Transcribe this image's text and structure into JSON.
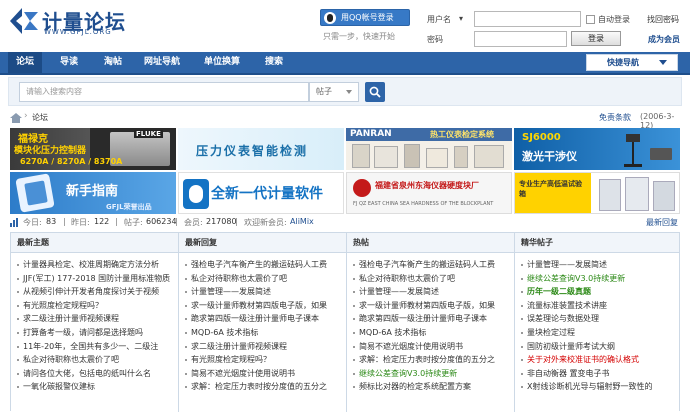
{
  "header": {
    "logo_cn": "计量论坛",
    "logo_url": "WWW.GFJL.ORG",
    "qq_login": "用QQ帐号登录",
    "quick_hint": "只需一步，快速开始",
    "username_label": "用户名",
    "password_label": "密码",
    "auto_login": "自动登录",
    "forgot_password": "找回密码",
    "login_button": "登录",
    "register": "成为会员"
  },
  "nav": {
    "items": [
      "论坛",
      "导读",
      "淘帖",
      "网址导航",
      "单位换算",
      "搜索"
    ],
    "quick_nav": "快捷导航"
  },
  "search": {
    "placeholder": "请输入搜索内容",
    "type": "帖子"
  },
  "breadcrumb": {
    "current": "论坛",
    "disclaimer": "免责条款",
    "date": "(2006-3-12)"
  },
  "banners": {
    "b1_l1": "福禄克",
    "b1_l2": "模块化压力控制器",
    "b1_l3": "6270A / 8270A / 8370A",
    "b1_brand": "FLUKE",
    "b2": "压力仪表智能检测",
    "b3_brand": "PANRAN",
    "b3_text": "热工仪表检定系统",
    "b4_model": "SJ6000",
    "b4_text": "激光干涉仪",
    "b5": "新手指南",
    "b5_sub": "GFJL荣誉出品",
    "b6": "全新一代计量软件",
    "b7": "福建省泉州东海仪器硬度块厂",
    "b7_sub": "FJ QZ EAST CHINA SEA HARDNESS OF THE BLOCKPLANT",
    "b8": "专业生产高低温试验箱"
  },
  "stats": {
    "today_label": "今日:",
    "today": "83",
    "yesterday_label": "昨日:",
    "yesterday": "122",
    "posts_label": "帖子:",
    "posts": "606234",
    "members_label": "会员:",
    "members": "217080",
    "newest_label": "欢迎新会员:",
    "newest": "AliMix",
    "latest_reply": "最新回复"
  },
  "columns": [
    {
      "title": "最新主题",
      "items": [
        {
          "t": "计量器具检定、校准周期确定方法分析"
        },
        {
          "t": "JJF(军工) 177-2018 国防计量用标准物质"
        },
        {
          "t": "从视频引伸计开发者角度探讨关于视频"
        },
        {
          "t": "有光照度检定规程吗？"
        },
        {
          "t": "求二级注册计量师视频课程"
        },
        {
          "t": "打算备考一级，请问都是选择题吗"
        },
        {
          "t": "11年-20年，全国共有多少一、二级注"
        },
        {
          "t": "私企对待职称也太震价了吧"
        },
        {
          "t": "请问各位大佬，包括电的纸叫什么名"
        },
        {
          "t": "一氧化碳报警仪建标"
        }
      ]
    },
    {
      "title": "最新回复",
      "items": [
        {
          "t": "强检电子汽车衡产生的搬运砝码人工费"
        },
        {
          "t": "私企对待职称也太震价了吧"
        },
        {
          "t": "计量管理——发展简述"
        },
        {
          "t": "求一级计量师教材第四版电子版，如果"
        },
        {
          "t": "跪求第四版一级注册计量师电子课本"
        },
        {
          "t": "MQD-6A 技术指标"
        },
        {
          "t": "求二级注册计量师视频课程"
        },
        {
          "t": "有光照度检定规程吗？"
        },
        {
          "t": "简易不遮光烟度计使用说明书"
        },
        {
          "t": "求解：检定压力表时按分度值的五分之"
        }
      ]
    },
    {
      "title": "热帖",
      "items": [
        {
          "t": "强检电子汽车衡产生的搬运砝码人工费"
        },
        {
          "t": "私企对待职称也太震价了吧"
        },
        {
          "t": "计量管理——发展简述"
        },
        {
          "t": "求一级计量师教材第四版电子版，如果"
        },
        {
          "t": "跪求第四版一级注册计量师电子课本"
        },
        {
          "t": "MQD-6A 技术指标"
        },
        {
          "t": "简易不遮光烟度计使用说明书"
        },
        {
          "t": "求解：检定压力表时按分度值的五分之"
        },
        {
          "t": "继续公差查询V3.0持续更新",
          "c": "green"
        },
        {
          "t": "频标比对器的检定系统配置方案"
        }
      ]
    },
    {
      "title": "精华帖子",
      "items": [
        {
          "t": "计量管理——发展简述"
        },
        {
          "t": "继续公差查询V3.0持续更新",
          "c": "green"
        },
        {
          "t": "历年一级二级真题",
          "c": "green",
          "b": true
        },
        {
          "t": "流量标准装置技术讲座"
        },
        {
          "t": "误差理论与数据处理"
        },
        {
          "t": "量块检定过程"
        },
        {
          "t": "国防初级计量师考试大纲"
        },
        {
          "t": "关于对外来校准证书的确认格式",
          "c": "red"
        },
        {
          "t": "非自动衡器 置变电子书"
        },
        {
          "t": "X射线诊断机光导与辐射野一致性的"
        }
      ]
    }
  ],
  "colors": {
    "nav_bg": "#2d64a8",
    "brand": "#1f4e8f",
    "red": "#d40000",
    "green": "#2d8a18"
  }
}
